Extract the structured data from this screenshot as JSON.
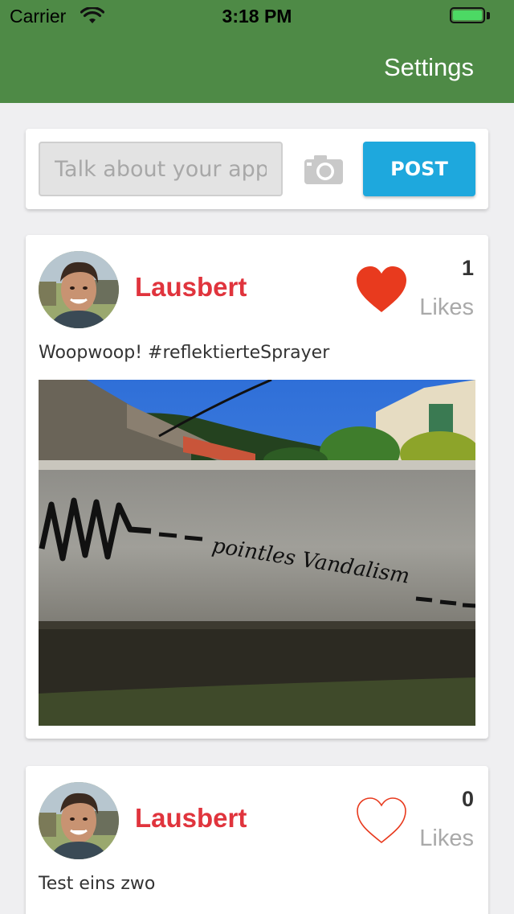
{
  "status_bar": {
    "carrier": "Carrier",
    "time": "3:18 PM"
  },
  "nav": {
    "settings_label": "Settings",
    "bar_color": "#4e8a46"
  },
  "composer": {
    "placeholder": "Talk about your app",
    "camera_icon": "camera-icon",
    "post_label": "POST",
    "post_color": "#1ea8dd"
  },
  "posts": [
    {
      "author": "Lausbert",
      "likes_count": "1",
      "likes_label": "Likes",
      "liked": true,
      "text": "Woopwoop! #reflektierteSprayer",
      "photo_graffiti": "pointles Vandalism"
    },
    {
      "author": "Lausbert",
      "likes_count": "0",
      "likes_label": "Likes",
      "liked": false,
      "text": "Test eins zwo"
    }
  ],
  "colors": {
    "author": "#e0343d",
    "heart": "#e83a1e"
  }
}
